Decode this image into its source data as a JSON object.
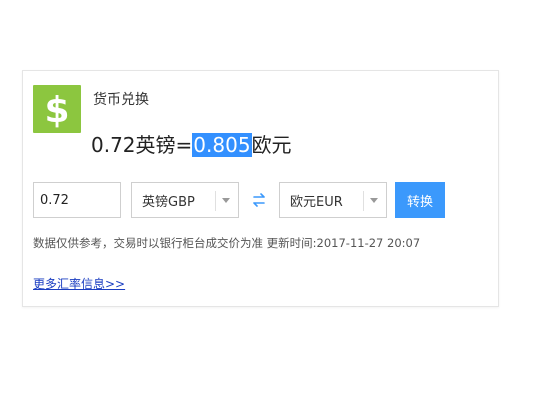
{
  "widget": {
    "title": "货币兑换",
    "result": {
      "amount_text": "0.72英镑=",
      "converted_value": "0.805",
      "target_unit": "欧元"
    },
    "controls": {
      "amount_value": "0.72",
      "from_currency": "英镑GBP",
      "to_currency": "欧元EUR",
      "convert_label": "转换"
    },
    "note": "数据仅供参考，交易时以银行柜台成交价为准 更新时间:2017-11-27 20:07",
    "more_link": "更多汇率信息>>"
  },
  "colors": {
    "logo_bg": "#8cc63f",
    "accent": "#3b99fc",
    "highlight": "#3390ff",
    "link": "#1a3dc1"
  },
  "icons": {
    "logo": "dollar-sign-icon",
    "swap": "swap-arrows-icon",
    "dropdown": "chevron-down-icon"
  }
}
